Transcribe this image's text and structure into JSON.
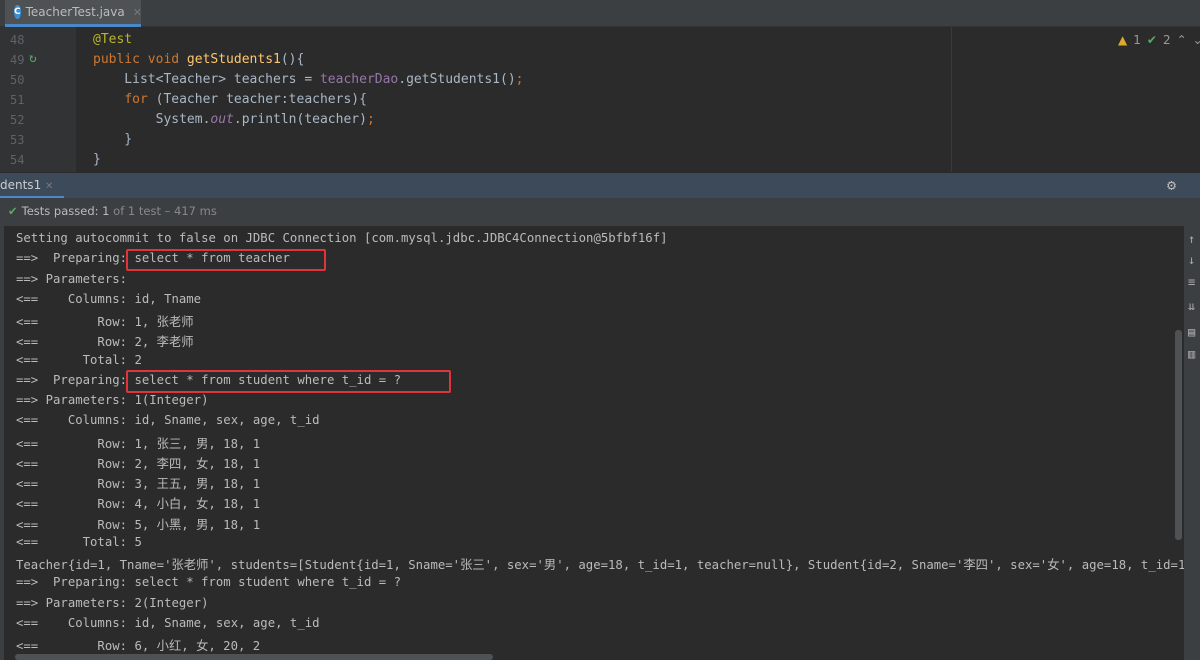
{
  "editor_tab": {
    "title": "TeacherTest.java",
    "icon": "java-class-icon"
  },
  "editor": {
    "line_numbers": [
      "48",
      "49",
      "50",
      "51",
      "52",
      "53",
      "54"
    ],
    "inspections": {
      "warnings": "1",
      "typos": "2"
    }
  },
  "tool_window": {
    "tab_label": "dents1"
  },
  "test_status": {
    "label": "Tests passed:",
    "count": "1",
    "detail": "of 1 test – 417 ms"
  },
  "console_lines": [
    "Setting autocommit to false on JDBC Connection [com.mysql.jdbc.JDBC4Connection@5bfbf16f]",
    "==>  Preparing: select * from teacher",
    "==> Parameters: ",
    "<==    Columns: id, Tname",
    "<==        Row: 1, 张老师",
    "<==        Row: 2, 李老师",
    "<==      Total: 2",
    "==>  Preparing: select * from student where t_id = ?",
    "==> Parameters: 1(Integer)",
    "<==    Columns: id, Sname, sex, age, t_id",
    "<==        Row: 1, 张三, 男, 18, 1",
    "<==        Row: 2, 李四, 女, 18, 1",
    "<==        Row: 3, 王五, 男, 18, 1",
    "<==        Row: 4, 小白, 女, 18, 1",
    "<==        Row: 5, 小黑, 男, 18, 1",
    "<==      Total: 5",
    "Teacher{id=1, Tname='张老师', students=[Student{id=1, Sname='张三', sex='男', age=18, t_id=1, teacher=null}, Student{id=2, Sname='李四', sex='女', age=18, t_id=1,",
    "==>  Preparing: select * from student where t_id = ?",
    "==> Parameters: 2(Integer)",
    "<==    Columns: id, Sname, sex, age, t_id",
    "<==        Row: 6, 小红, 女, 20, 2"
  ]
}
